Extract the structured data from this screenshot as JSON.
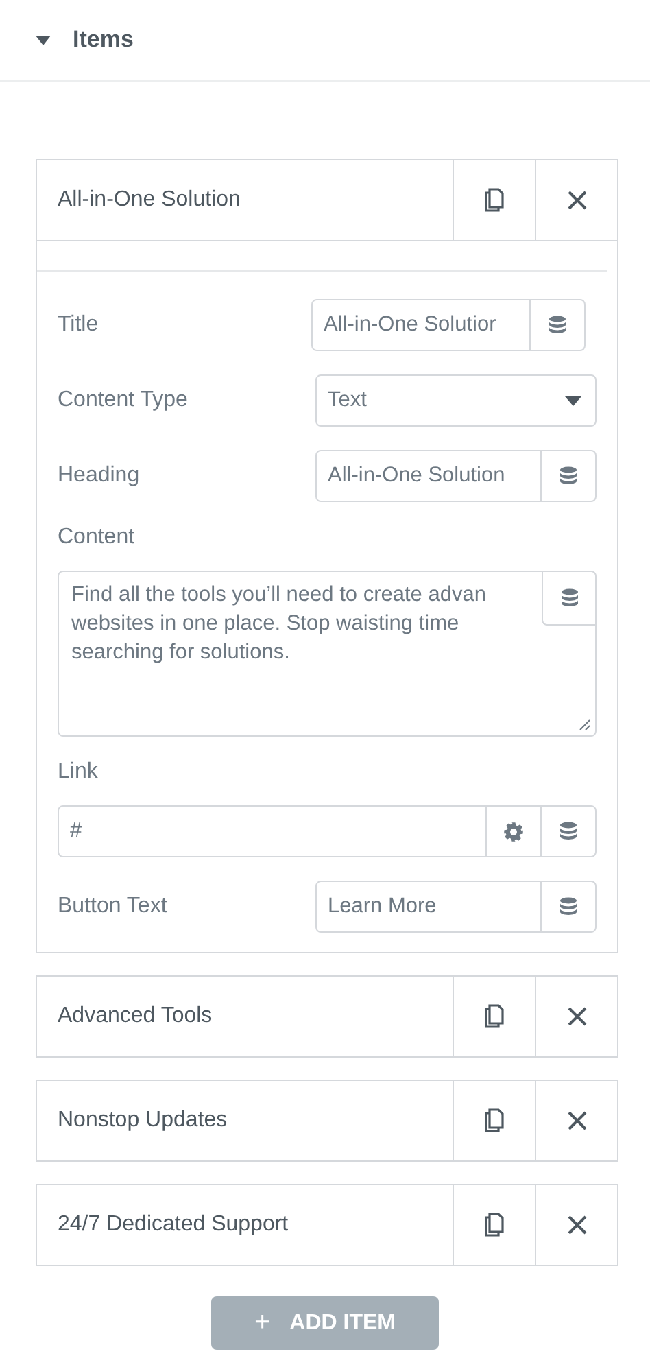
{
  "section": {
    "title": "Items",
    "expanded": true
  },
  "items": [
    {
      "title": "All-in-One Solution",
      "expanded": true,
      "fields": [
        {
          "kind": "text",
          "label": "Title",
          "value": "All-in-One Solutior",
          "dynamic": true
        },
        {
          "kind": "select",
          "label": "Content Type",
          "value": "Text"
        },
        {
          "kind": "text",
          "label": "Heading",
          "value": "All-in-One Solution",
          "dynamic": true
        },
        {
          "kind": "textarea",
          "label": "Content",
          "lines": [
            "Find all the tools you’ll need to create advan",
            "websites in one place. Stop waisting time",
            "searching for solutions."
          ],
          "dynamic": true
        },
        {
          "kind": "url",
          "label": "Link",
          "value": "#",
          "dynamic": true
        },
        {
          "kind": "text",
          "label": "Button Text",
          "value": "Learn More",
          "dynamic": true
        }
      ]
    },
    {
      "title": "Advanced Tools",
      "expanded": false
    },
    {
      "title": "Nonstop Updates",
      "expanded": false
    },
    {
      "title": "24/7 Dedicated Support",
      "expanded": false
    }
  ],
  "add_button": {
    "icon": "+",
    "label": "ADD ITEM"
  }
}
